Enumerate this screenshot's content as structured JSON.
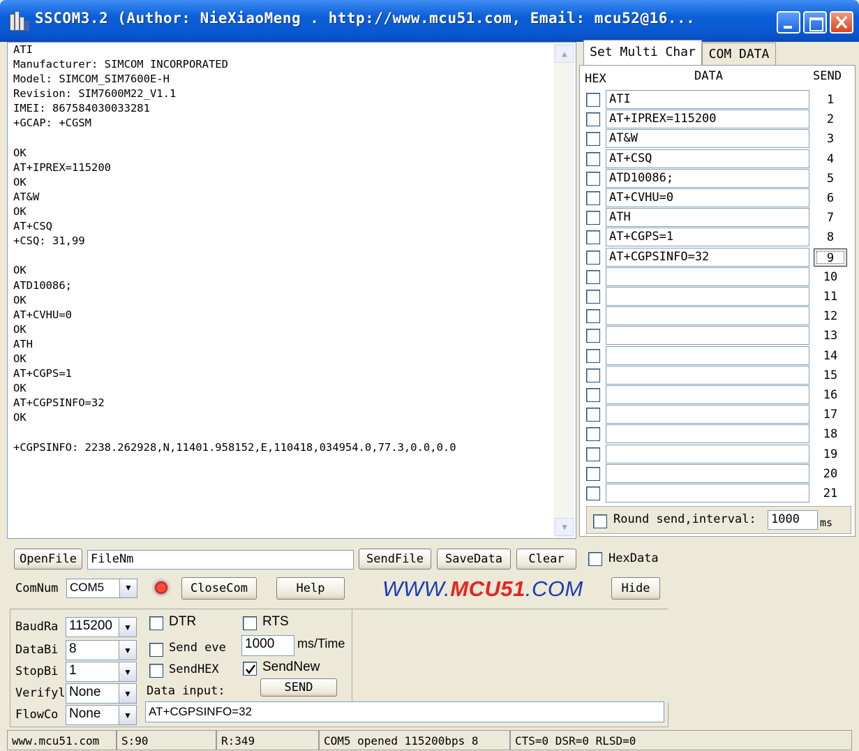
{
  "window": {
    "title": "SSCOM3.2 (Author: NieXiaoMeng . http://www.mcu51.com, Email: mcu52@16...",
    "colors": {
      "titlebar": "#0a5fd8",
      "close": "#d9431c",
      "logo_blue": "#1d3bb5",
      "logo_red": "#e8241e"
    }
  },
  "receive_text": "ATI\nManufacturer: SIMCOM INCORPORATED\nModel: SIMCOM_SIM7600E-H\nRevision: SIM7600M22_V1.1\nIMEI: 867584030033281\n+GCAP: +CGSM\n\nOK\nAT+IPREX=115200\nOK\nAT&W\nOK\nAT+CSQ\n+CSQ: 31,99\n\nOK\nATD10086;\nOK\nAT+CVHU=0\nOK\nATH\nOK\nAT+CGPS=1\nOK\nAT+CGPSINFO=32\nOK\n\n+CGPSINFO: 2238.262928,N,11401.958152,E,110418,034954.0,77.3,0.0,0.0",
  "tabs": [
    "Set Multi Char",
    "COM DATA"
  ],
  "multi": {
    "headers": {
      "hex": "HEX",
      "data": "DATA",
      "send": "SEND"
    },
    "rows": [
      {
        "data": "ATI",
        "send": "1"
      },
      {
        "data": "AT+IPREX=115200",
        "send": "2"
      },
      {
        "data": "AT&W",
        "send": "3"
      },
      {
        "data": "AT+CSQ",
        "send": "4"
      },
      {
        "data": "ATD10086;",
        "send": "5"
      },
      {
        "data": "AT+CVHU=0",
        "send": "6"
      },
      {
        "data": "ATH",
        "send": "7"
      },
      {
        "data": "AT+CGPS=1",
        "send": "8"
      },
      {
        "data": "AT+CGPSINFO=32",
        "send": "9"
      },
      {
        "data": "",
        "send": "10"
      },
      {
        "data": "",
        "send": "11"
      },
      {
        "data": "",
        "send": "12"
      },
      {
        "data": "",
        "send": "13"
      },
      {
        "data": "",
        "send": "14"
      },
      {
        "data": "",
        "send": "15"
      },
      {
        "data": "",
        "send": "16"
      },
      {
        "data": "",
        "send": "17"
      },
      {
        "data": "",
        "send": "18"
      },
      {
        "data": "",
        "send": "19"
      },
      {
        "data": "",
        "send": "20"
      },
      {
        "data": "",
        "send": "21"
      }
    ],
    "round_label": "Round send,interval:",
    "interval": "1000",
    "unit": "ms"
  },
  "toolbar": {
    "openfile": "OpenFile",
    "filename": "FileNm",
    "sendfile": "SendFile",
    "savedata": "SaveData",
    "clear": "Clear",
    "hexdata": "HexData",
    "comnum_label": "ComNum",
    "comnum": "COM5",
    "closecom": "CloseCom",
    "help": "Help",
    "logo_pre": "WWW.",
    "logo_mid": "MCU51",
    "logo_post": ".COM",
    "hide": "Hide"
  },
  "settings": {
    "baud_label": "BaudRa",
    "baud": "115200",
    "databits_label": "DataBi",
    "databits": "8",
    "stopbits_label": "StopBi",
    "stopbits": "1",
    "verify_label": "Verifyl",
    "verify": "None",
    "flow_label": "FlowCo",
    "flow": "None",
    "dtr": "DTR",
    "rts": "RTS",
    "send_every": "Send eve",
    "send_every_value": "1000",
    "ms_time": "ms/Time",
    "sendhex": "SendHEX",
    "sendnew": "SendNew",
    "data_input_label": "Data input:",
    "send_button": "SEND",
    "data_input": "AT+CGPSINFO=32"
  },
  "status": {
    "site": "www.mcu51.com",
    "sent": "S:90",
    "received": "R:349",
    "port": "COM5 opened 115200bps  8",
    "lines": "CTS=0 DSR=0 RLSD=0"
  }
}
